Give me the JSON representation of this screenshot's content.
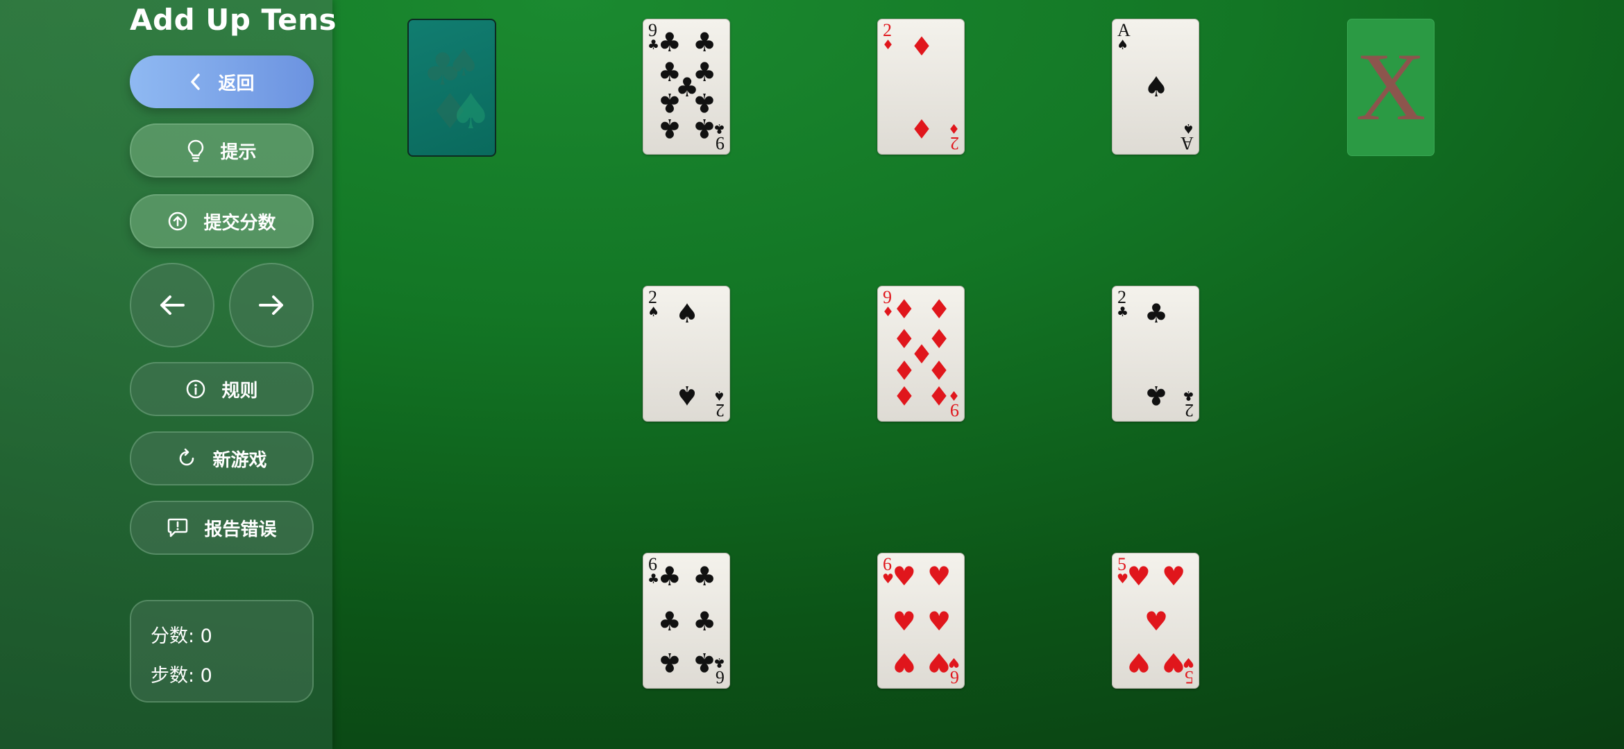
{
  "app": {
    "title": "Add Up Tens"
  },
  "sidebar": {
    "back_label": "返回",
    "hint_label": "提示",
    "submit_label": "提交分数",
    "rules_label": "规则",
    "new_game_label": "新游戏",
    "report_label": "报告错误"
  },
  "stats": {
    "score": "分数: 0",
    "moves": "步数: 0"
  },
  "colors": {
    "felt": "#137625",
    "back_button": "#7aa3e8",
    "deck_back": "#0e7567",
    "card_red": "#e0161c",
    "card_black": "#111111",
    "discard_x": "#9e4a4f"
  },
  "discard": {
    "mark": "X"
  },
  "cards": [
    {
      "rank": "9",
      "suit": "♣",
      "color": "black"
    },
    {
      "rank": "2",
      "suit": "♦",
      "color": "red"
    },
    {
      "rank": "A",
      "suit": "♠",
      "color": "black"
    },
    {
      "rank": "2",
      "suit": "♠",
      "color": "black"
    },
    {
      "rank": "9",
      "suit": "♦",
      "color": "red"
    },
    {
      "rank": "2",
      "suit": "♣",
      "color": "black"
    },
    {
      "rank": "6",
      "suit": "♣",
      "color": "black"
    },
    {
      "rank": "6",
      "suit": "♥",
      "color": "red"
    },
    {
      "rank": "5",
      "suit": "♥",
      "color": "red"
    }
  ]
}
